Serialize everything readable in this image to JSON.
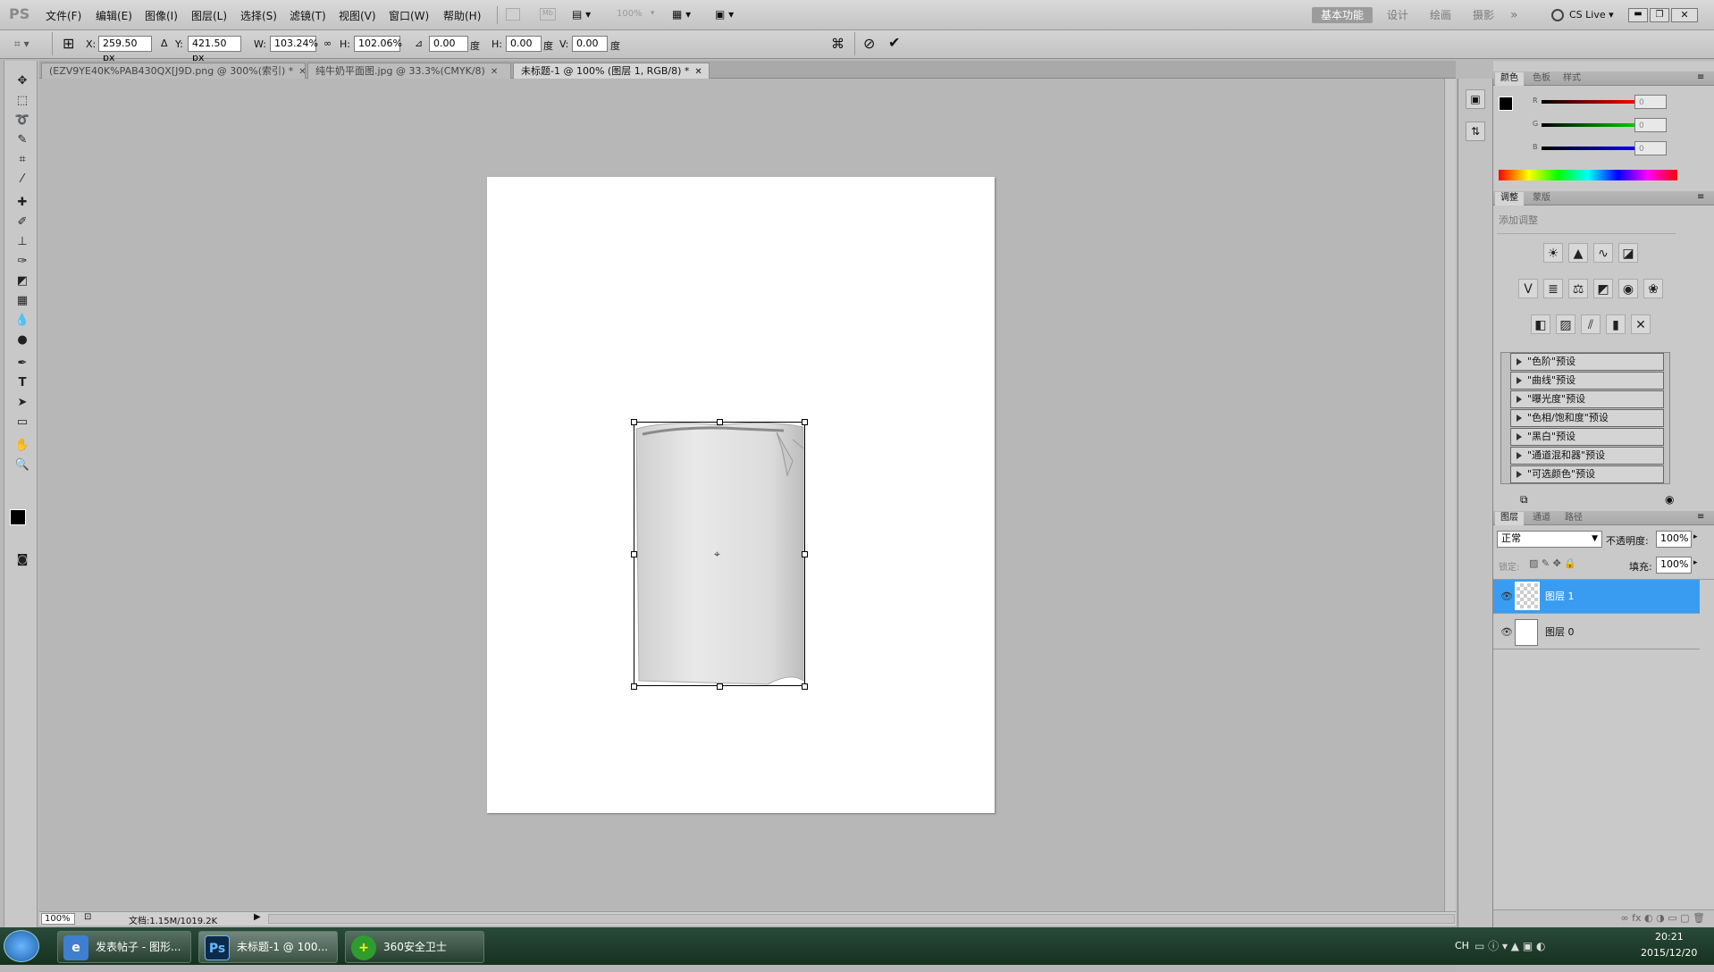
{
  "app": {
    "logo": "PS"
  },
  "menu": [
    "文件(F)",
    "编辑(E)",
    "图像(I)",
    "图层(L)",
    "选择(S)",
    "滤镜(T)",
    "视图(V)",
    "窗口(W)",
    "帮助(H)"
  ],
  "top_toolbar": {
    "zoom": "100%"
  },
  "workspaces": [
    "基本功能",
    "设计",
    "绘画",
    "摄影",
    "»"
  ],
  "cslive": "CS Live ▾",
  "options": {
    "x_label": "X:",
    "x_value": "259.50 px",
    "y_label": "Y:",
    "y_value": "421.50 px",
    "w_label": "W:",
    "w_value": "103.24%",
    "h_label": "H:",
    "h_value": "102.06%",
    "angle_value": "0.00",
    "angle_unit": "度",
    "hskew_label": "H:",
    "hskew_value": "0.00",
    "hskew_unit": "度",
    "vskew_label": "V:",
    "vskew_value": "0.00",
    "vskew_unit": "度"
  },
  "tabs": [
    {
      "label": "(EZV9YE40K%PAB430QX[J9D.png @ 300%(索引) *"
    },
    {
      "label": "纯牛奶平面图.jpg @ 33.3%(CMYK/8)"
    },
    {
      "label": "未标题-1 @ 100% (图层 1, RGB/8) *"
    }
  ],
  "status": {
    "zoom": "100%",
    "doc": "文档:1.15M/1019.2K"
  },
  "color_panel": {
    "tabs": [
      "颜色",
      "色板",
      "样式"
    ],
    "r_label": "R",
    "r_value": "0",
    "g_label": "G",
    "g_value": "0",
    "b_label": "B",
    "b_value": "0"
  },
  "adjust_panel": {
    "tabs": [
      "调整",
      "蒙版"
    ],
    "title": "添加调整",
    "presets": [
      "\"色阶\"预设",
      "\"曲线\"预设",
      "\"曝光度\"预设",
      "\"色相/饱和度\"预设",
      "\"黑白\"预设",
      "\"通道混和器\"预设",
      "\"可选颜色\"预设"
    ]
  },
  "layers_panel": {
    "tabs": [
      "图层",
      "通道",
      "路径"
    ],
    "blend_mode": "正常",
    "opacity_label": "不透明度:",
    "opacity": "100%",
    "lock_label": "锁定:",
    "fill_label": "填充:",
    "fill": "100%",
    "layers": [
      {
        "name": "图层 1",
        "selected": true
      },
      {
        "name": "图层 0",
        "selected": false
      }
    ]
  },
  "taskbar": {
    "items": [
      {
        "label": "发表帖子 - 图形..."
      },
      {
        "label": "未标题-1 @ 100..."
      },
      {
        "label": "360安全卫士"
      }
    ],
    "lang": "CH",
    "time": "20:21",
    "date": "2015/12/20"
  },
  "colors": {
    "selection": "#3a9cf0",
    "taskbar": "#1f3b2a"
  }
}
